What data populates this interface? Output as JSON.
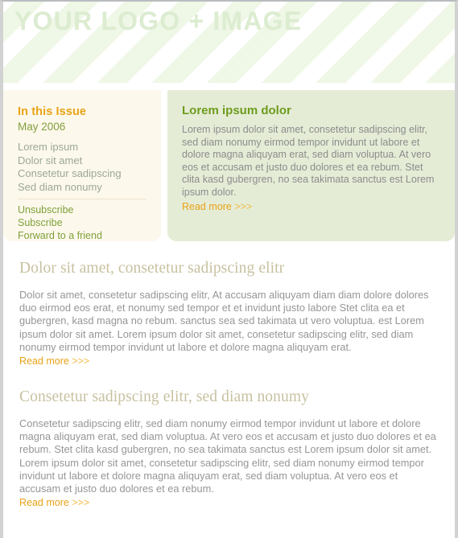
{
  "banner": {
    "logo_text": "YOUR LOGO + IMAGE"
  },
  "issue_panel": {
    "title": "In this Issue",
    "date": "May 2006",
    "items": [
      "Lorem ipsum",
      "Dolor sit amet",
      "Consetetur sadipscing",
      "Sed diam nonumy"
    ],
    "links": [
      "Unsubscribe",
      "Subscribe",
      "Forward to a friend"
    ]
  },
  "promo_panel": {
    "title": "Lorem ipsum dolor",
    "body": "Lorem ipsum dolor sit amet, consetetur sadipscing elitr, sed diam nonumy eirmod tempor invidunt ut labore et dolore magna aliquyam erat, sed diam voluptua. At vero eos et accusam et justo duo dolores et ea rebum. Stet clita kasd gubergren, no sea takimata sanctus est Lorem ipsum dolor.",
    "read_more_label": "Read more",
    "read_more_chevrons": ">>>"
  },
  "articles": [
    {
      "title": "Dolor sit amet, consetetur sadipscing elitr",
      "body": "Dolor sit amet, consetetur sadipscing elitr, At accusam aliquyam diam diam dolore dolores duo eirmod eos erat, et nonumy sed tempor et et invidunt justo labore Stet clita ea et gubergren, kasd magna no rebum. sanctus sea sed takimata ut vero voluptua. est Lorem ipsum dolor sit amet. Lorem ipsum dolor sit amet, consetetur sadipscing elitr, sed diam nonumy eirmod tempor invidunt ut labore et dolore magna aliquyam erat.",
      "read_more_label": "Read more",
      "read_more_chevrons": ">>>"
    },
    {
      "title": "Consetetur sadipscing elitr, sed diam nonumy",
      "body": "Consetetur sadipscing elitr, sed diam nonumy eirmod tempor invidunt ut labore et dolore magna aliquyam erat, sed diam voluptua. At vero eos et accusam et justo duo dolores et ea rebum. Stet clita kasd gubergren, no sea takimata sanctus est Lorem ipsum dolor sit amet. Lorem ipsum dolor sit amet, consetetur sadipscing elitr, sed diam nonumy eirmod tempor invidunt ut labore et dolore magna aliquyam erat, sed diam voluptua. At vero eos et accusam et justo duo dolores et ea rebum.",
      "read_more_label": "Read more",
      "read_more_chevrons": ">>>"
    }
  ],
  "colors": {
    "accent_orange": "#e8a317",
    "accent_green": "#6d9c1d",
    "link_green": "#7ea13b",
    "body_gray": "#969696",
    "heading_khaki": "#c8c1a0",
    "panel_cream": "#fdf8ec",
    "panel_green": "#e5ecd6",
    "logo_green": "#dcecd0",
    "stripe_green": "#eff7e6"
  }
}
